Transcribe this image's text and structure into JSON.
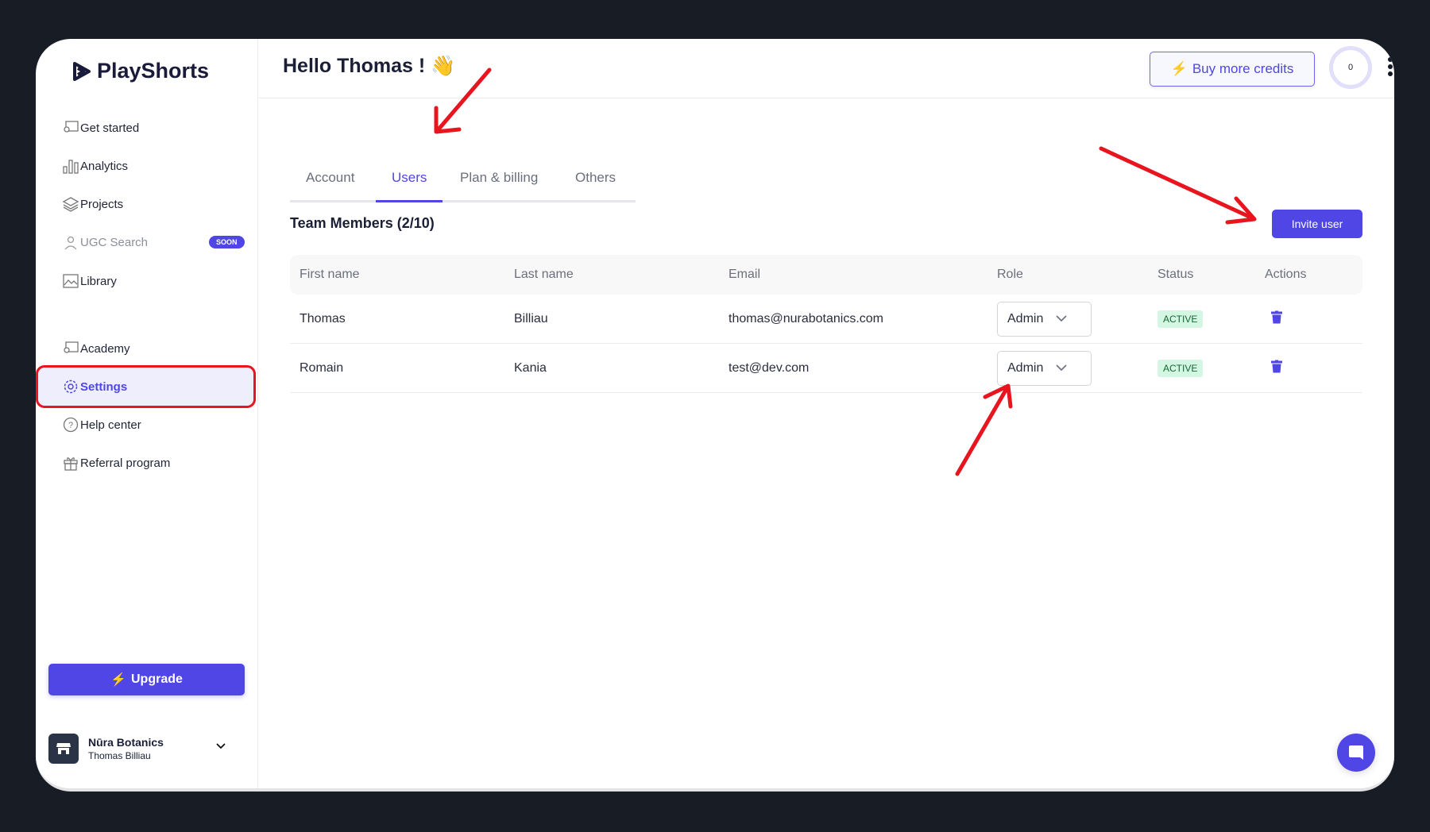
{
  "brand": {
    "name": "PlayShorts"
  },
  "sidebar": {
    "items": [
      {
        "label": "Get started",
        "icon": "presentation-icon"
      },
      {
        "label": "Analytics",
        "icon": "bar-chart-icon"
      },
      {
        "label": "Projects",
        "icon": "layers-icon"
      },
      {
        "label": "UGC Search",
        "icon": "user-search-icon",
        "badge": "SOON"
      },
      {
        "label": "Library",
        "icon": "image-icon"
      },
      {
        "label": "Academy",
        "icon": "presentation-icon"
      },
      {
        "label": "Settings",
        "icon": "gear-icon",
        "active": true
      },
      {
        "label": "Help center",
        "icon": "help-circle-icon"
      },
      {
        "label": "Referral program",
        "icon": "gift-icon"
      }
    ],
    "upgrade_label": "Upgrade",
    "workspace": {
      "name": "Nūra Botanics",
      "user": "Thomas Billiau"
    }
  },
  "header": {
    "greeting": "Hello Thomas ! 👋",
    "buy_credits": "Buy more credits",
    "credits": "0"
  },
  "tabs": [
    {
      "label": "Account"
    },
    {
      "label": "Users",
      "active": true
    },
    {
      "label": "Plan & billing"
    },
    {
      "label": "Others"
    }
  ],
  "team": {
    "title": "Team Members (2/10)",
    "invite_label": "Invite user",
    "columns": [
      "First name",
      "Last name",
      "Email",
      "Role",
      "Status",
      "Actions"
    ],
    "rows": [
      {
        "first": "Thomas",
        "last": "Billiau",
        "email": "thomas@nurabotanics.com",
        "role": "Admin",
        "status": "ACTIVE"
      },
      {
        "first": "Romain",
        "last": "Kania",
        "email": "test@dev.com",
        "role": "Admin",
        "status": "ACTIVE"
      }
    ]
  },
  "colors": {
    "accent": "#4f46e5",
    "annotation": "#e8141e",
    "active_bg": "#d4f7e3"
  }
}
